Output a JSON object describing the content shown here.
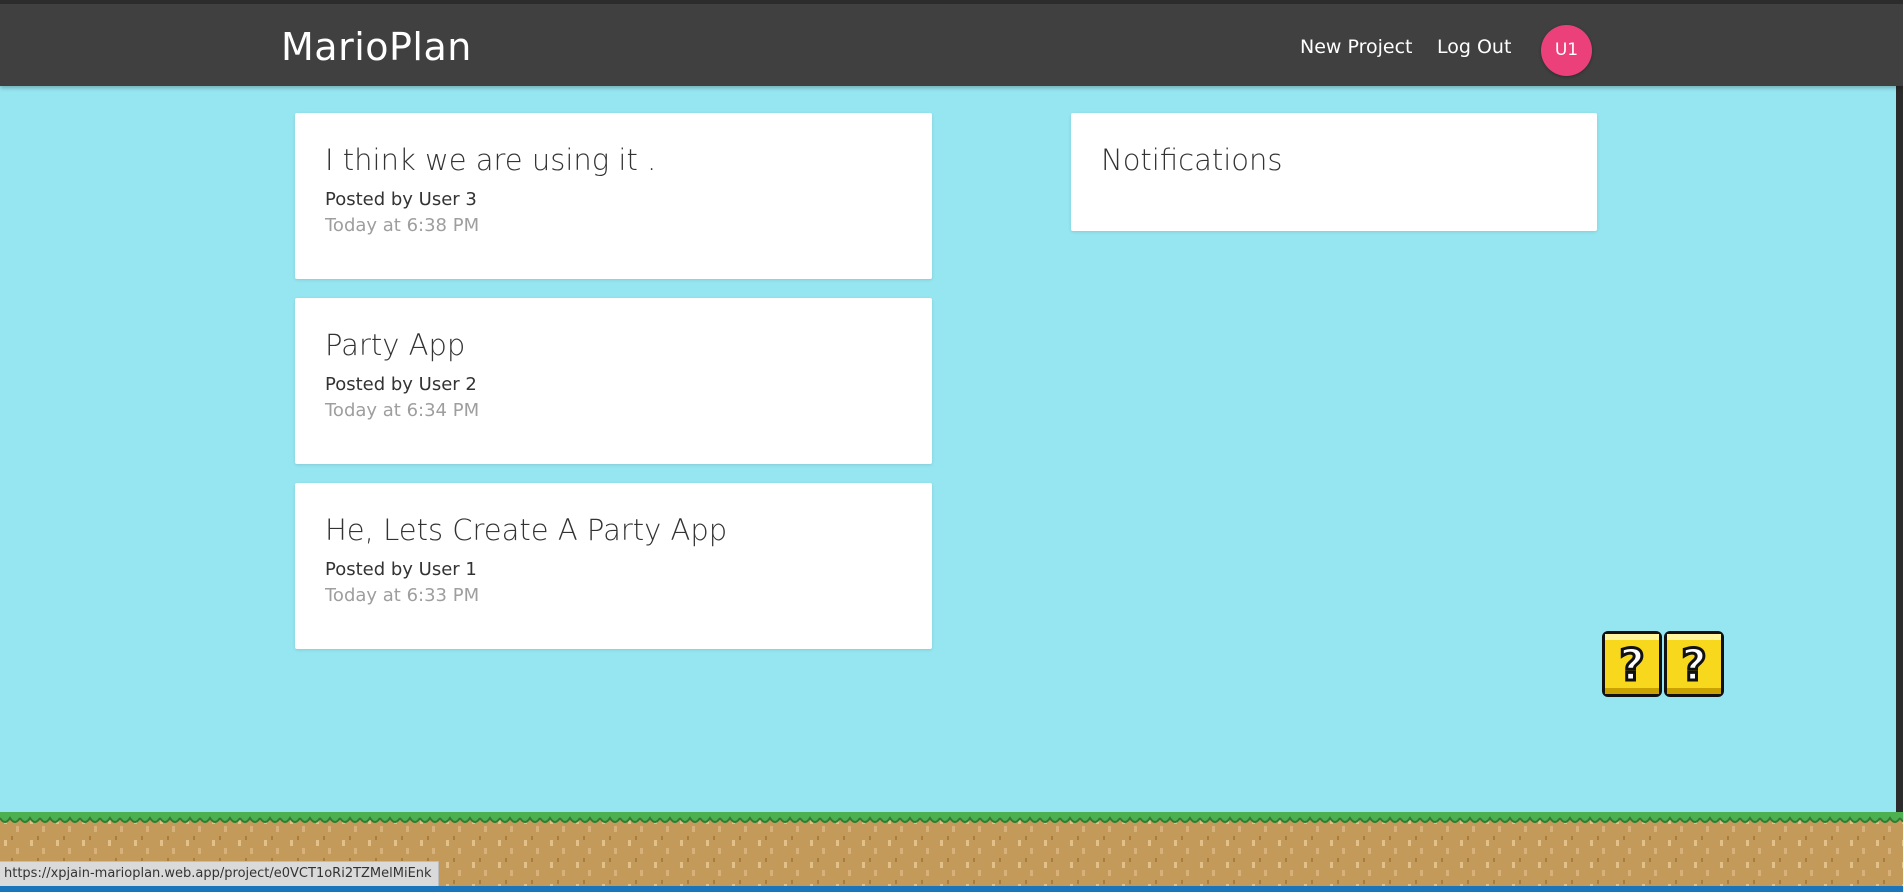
{
  "header": {
    "brand": "MarioPlan",
    "nav": {
      "new_project": "New Project",
      "log_out": "Log Out"
    },
    "avatar_initials": "U1",
    "avatar_color": "#ec407a"
  },
  "projects": [
    {
      "title": "I think we are using it .",
      "author": "Posted by User 3",
      "date": "Today at 6:38 PM"
    },
    {
      "title": "Party App",
      "author": "Posted by User 2",
      "date": "Today at 6:34 PM"
    },
    {
      "title": "He, Lets Create A Party App",
      "author": "Posted by User 1",
      "date": "Today at 6:33 PM"
    }
  ],
  "notifications": {
    "title": "Notifications"
  },
  "status_url": "https://xpjain-marioplan.web.app/project/e0VCT1oRi2TZMelMiEnk",
  "colors": {
    "sky": "#96e6f1",
    "navbar": "#404040",
    "grass": "#4caf50",
    "dirt": "#c49a5a"
  },
  "decorations": {
    "question_blocks": 2
  }
}
